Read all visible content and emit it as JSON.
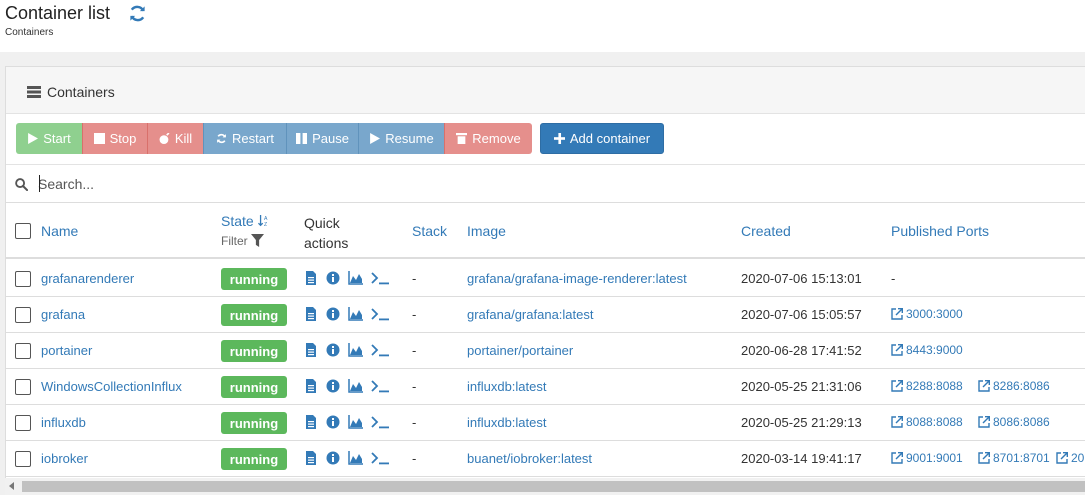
{
  "header": {
    "title": "Container list",
    "breadcrumb": "Containers"
  },
  "widget": {
    "title": "Containers"
  },
  "toolbar": {
    "start": "Start",
    "stop": "Stop",
    "kill": "Kill",
    "restart": "Restart",
    "pause": "Pause",
    "resume": "Resume",
    "remove": "Remove",
    "add": "Add container"
  },
  "search": {
    "placeholder": "Search..."
  },
  "columns": {
    "name": "Name",
    "state": "State",
    "state_filter": "Filter",
    "quick_actions_line1": "Quick",
    "quick_actions_line2": "actions",
    "stack": "Stack",
    "image": "Image",
    "created": "Created",
    "ports": "Published Ports"
  },
  "colors": {
    "link": "#337ab7",
    "running": "#5cb85c",
    "danger": "#e58f8c",
    "info": "#79a7cc",
    "success": "#8fd08f",
    "primary": "#337ab7"
  },
  "rows": [
    {
      "name": "grafanarenderer",
      "state": "running",
      "stack": "-",
      "image": "grafana/grafana-image-renderer:latest",
      "created": "2020-07-06 15:13:01",
      "ports_text": "-",
      "ports": []
    },
    {
      "name": "grafana",
      "state": "running",
      "stack": "-",
      "image": "grafana/grafana:latest",
      "created": "2020-07-06 15:05:57",
      "ports_text": "",
      "ports": [
        "3000:3000"
      ]
    },
    {
      "name": "portainer",
      "state": "running",
      "stack": "-",
      "image": "portainer/portainer",
      "created": "2020-06-28 17:41:52",
      "ports_text": "",
      "ports": [
        "8443:9000"
      ]
    },
    {
      "name": "WindowsCollectionInflux",
      "state": "running",
      "stack": "-",
      "image": "influxdb:latest",
      "created": "2020-05-25 21:31:06",
      "ports_text": "",
      "ports": [
        "8288:8088",
        "8286:8086"
      ]
    },
    {
      "name": "influxdb",
      "state": "running",
      "stack": "-",
      "image": "influxdb:latest",
      "created": "2020-05-25 21:29:13",
      "ports_text": "",
      "ports": [
        "8088:8088",
        "8086:8086"
      ]
    },
    {
      "name": "iobroker",
      "state": "running",
      "stack": "-",
      "image": "buanet/iobroker:latest",
      "created": "2020-03-14 19:41:17",
      "ports_text": "",
      "ports": [
        "9001:9001",
        "8701:8701",
        "20"
      ]
    }
  ],
  "icons": {
    "refresh": "refresh-icon",
    "list": "list-icon",
    "search": "search-icon",
    "sort": "sort-alpha-icon",
    "filter": "filter-icon",
    "logs": "file-icon",
    "inspect": "info-icon",
    "stats": "area-chart-icon",
    "console": "terminal-icon",
    "external": "external-link-icon"
  }
}
